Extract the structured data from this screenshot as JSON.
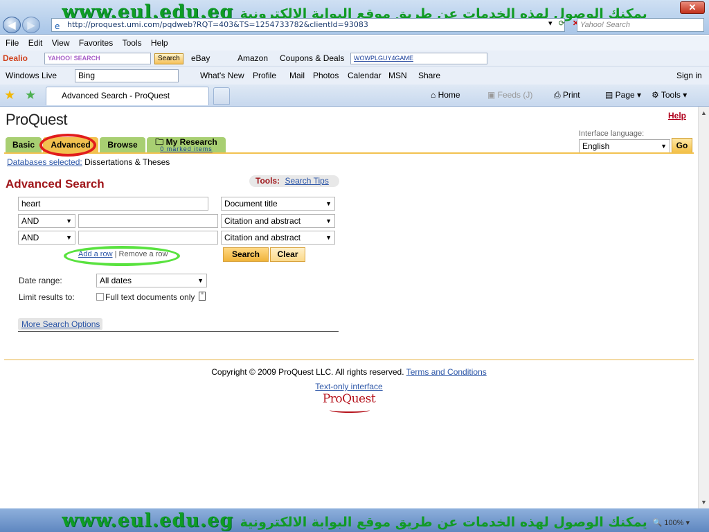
{
  "overlay": {
    "banner_url": "www.eul.edu.eg",
    "banner_arabic": "يمكنك الوصول لهذه الخدمات عن طريق موقع البوابة الالكترونية"
  },
  "browser": {
    "address": "http://proquest.umi.com/pqdweb?RQT=403&TS=1254733782&clientId=93083",
    "search_placeholder": "Yahoo! Search",
    "menu": [
      "File",
      "Edit",
      "View",
      "Favorites",
      "Tools",
      "Help"
    ],
    "toolbar2": {
      "dealio": "Dealio",
      "yahoo_search": "YAHOO! SEARCH",
      "search_btn": "Search",
      "ebay": "eBay",
      "amazon": "Amazon",
      "coupons": "Coupons & Deals",
      "coupon_code": "WOWPLGUY4GAME"
    },
    "toolbar3": {
      "windows_live": "Windows Live",
      "bing": "Bing",
      "links": [
        "What's New",
        "Profile",
        "Mail",
        "Photos",
        "Calendar",
        "MSN",
        "Share"
      ],
      "sign_in": "Sign in"
    },
    "tab_title": "Advanced Search - ProQuest",
    "command_bar": {
      "home": "Home",
      "feeds": "Feeds (J)",
      "print": "Print",
      "page": "Page",
      "tools": "Tools"
    },
    "zoom": "100%"
  },
  "page": {
    "logo": "ProQuest",
    "help": "Help",
    "interface_language_label": "Interface language:",
    "interface_language": "English",
    "go": "Go",
    "tabs": {
      "basic": "Basic",
      "advanced": "Advanced",
      "browse": "Browse",
      "my_research": "My Research",
      "marked_items": "0 marked items"
    },
    "databases_selected_link": "Databases selected:",
    "databases_selected_value": "Dissertations & Theses",
    "title": "Advanced Search",
    "tools_label": "Tools:",
    "search_tips": "Search Tips",
    "rows": [
      {
        "operator": "",
        "term": "heart",
        "field": "Document title"
      },
      {
        "operator": "AND",
        "term": "",
        "field": "Citation and abstract"
      },
      {
        "operator": "AND",
        "term": "",
        "field": "Citation and abstract"
      }
    ],
    "add_row": "Add a row",
    "separator": "|",
    "remove_row": "Remove a row",
    "search_button": "Search",
    "clear_button": "Clear",
    "date_range_label": "Date range:",
    "date_range_value": "All dates",
    "limit_label": "Limit results to:",
    "full_text_label": "Full text documents only",
    "more_options": "More Search Options",
    "copyright": "Copyright © 2009 ProQuest LLC. All rights reserved.",
    "terms": "Terms and Conditions",
    "text_only": "Text-only interface",
    "footer_logo": "ProQuest"
  }
}
